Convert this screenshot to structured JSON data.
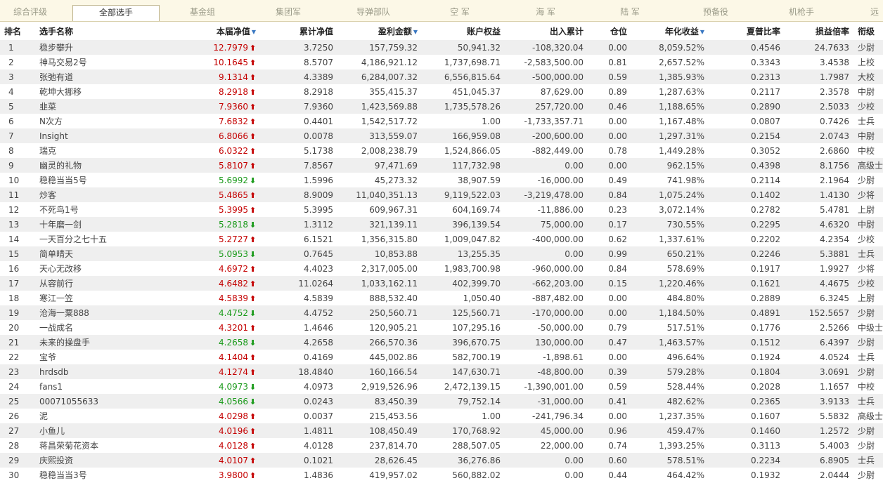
{
  "tabs": [
    {
      "label": "综合评级",
      "active": false
    },
    {
      "label": "全部选手",
      "active": true
    },
    {
      "label": "基金组",
      "active": false
    },
    {
      "label": "集团军",
      "active": false
    },
    {
      "label": "导弹部队",
      "active": false
    },
    {
      "label": "空 军",
      "active": false
    },
    {
      "label": "海 军",
      "active": false
    },
    {
      "label": "陆 军",
      "active": false
    },
    {
      "label": "预备役",
      "active": false
    },
    {
      "label": "机枪手",
      "active": false
    },
    {
      "label": "远",
      "active": false
    }
  ],
  "colors": {
    "up": "#c40000",
    "down": "#1a9a1a",
    "sort": "#3a78c2"
  },
  "table": {
    "headers": [
      "排名",
      "选手名称",
      "本届净值",
      "累计净值",
      "盈利金额",
      "账户权益",
      "出入累计",
      "仓位",
      "年化收益",
      "夏普比率",
      "损益倍率",
      "衔级"
    ],
    "sortable_icon": "sort-down-triangle-icon",
    "rows": [
      {
        "rank": "1",
        "name": "稳步攀升",
        "nav": "12.7979",
        "dir": "up",
        "cum": "3.7250",
        "profit": "157,759.32",
        "equity": "50,941.32",
        "flow": "-108,320.04",
        "pos": "0.00",
        "annual": "8,059.52%",
        "sharpe": "0.4546",
        "pl": "24.7633",
        "grade": "少尉"
      },
      {
        "rank": "2",
        "name": "神马交易2号",
        "nav": "10.1645",
        "dir": "up",
        "cum": "8.5707",
        "profit": "4,186,921.12",
        "equity": "1,737,698.71",
        "flow": "-2,583,500.00",
        "pos": "0.81",
        "annual": "2,657.52%",
        "sharpe": "0.3343",
        "pl": "3.4538",
        "grade": "上校"
      },
      {
        "rank": "3",
        "name": "张弛有道",
        "nav": "9.1314",
        "dir": "up",
        "cum": "4.3389",
        "profit": "6,284,007.32",
        "equity": "6,556,815.64",
        "flow": "-500,000.00",
        "pos": "0.59",
        "annual": "1,385.93%",
        "sharpe": "0.2313",
        "pl": "1.7987",
        "grade": "大校"
      },
      {
        "rank": "4",
        "name": "乾坤大挪移",
        "nav": "8.2918",
        "dir": "up",
        "cum": "8.2918",
        "profit": "355,415.37",
        "equity": "451,045.37",
        "flow": "87,629.00",
        "pos": "0.89",
        "annual": "1,287.63%",
        "sharpe": "0.2117",
        "pl": "2.3578",
        "grade": "中尉"
      },
      {
        "rank": "5",
        "name": "韭菜",
        "nav": "7.9360",
        "dir": "up",
        "cum": "7.9360",
        "profit": "1,423,569.88",
        "equity": "1,735,578.26",
        "flow": "257,720.00",
        "pos": "0.46",
        "annual": "1,188.65%",
        "sharpe": "0.2890",
        "pl": "2.5033",
        "grade": "少校"
      },
      {
        "rank": "6",
        "name": "N次方",
        "nav": "7.6832",
        "dir": "up",
        "cum": "0.4401",
        "profit": "1,542,517.72",
        "equity": "1.00",
        "flow": "-1,733,357.71",
        "pos": "0.00",
        "annual": "1,167.48%",
        "sharpe": "0.0807",
        "pl": "0.7426",
        "grade": "士兵"
      },
      {
        "rank": "7",
        "name": "Insight",
        "nav": "6.8066",
        "dir": "up",
        "cum": "0.0078",
        "profit": "313,559.07",
        "equity": "166,959.08",
        "flow": "-200,600.00",
        "pos": "0.00",
        "annual": "1,297.31%",
        "sharpe": "0.2154",
        "pl": "2.0743",
        "grade": "中尉"
      },
      {
        "rank": "8",
        "name": "瑞克",
        "nav": "6.0322",
        "dir": "up",
        "cum": "5.1738",
        "profit": "2,008,238.79",
        "equity": "1,524,866.05",
        "flow": "-882,449.00",
        "pos": "0.78",
        "annual": "1,449.28%",
        "sharpe": "0.3052",
        "pl": "2.6860",
        "grade": "中校"
      },
      {
        "rank": "9",
        "name": "幽灵的礼物",
        "nav": "5.8107",
        "dir": "up",
        "cum": "7.8567",
        "profit": "97,471.69",
        "equity": "117,732.98",
        "flow": "0.00",
        "pos": "0.00",
        "annual": "962.15%",
        "sharpe": "0.4398",
        "pl": "8.1756",
        "grade": "高级士官"
      },
      {
        "rank": "10",
        "name": "稳稳当当5号",
        "nav": "5.6992",
        "dir": "down",
        "cum": "1.5996",
        "profit": "45,273.32",
        "equity": "38,907.59",
        "flow": "-16,000.00",
        "pos": "0.49",
        "annual": "741.98%",
        "sharpe": "0.2114",
        "pl": "2.1964",
        "grade": "少尉"
      },
      {
        "rank": "11",
        "name": "炒客",
        "nav": "5.4865",
        "dir": "up",
        "cum": "8.9009",
        "profit": "11,040,351.13",
        "equity": "9,119,522.03",
        "flow": "-3,219,478.00",
        "pos": "0.84",
        "annual": "1,075.24%",
        "sharpe": "0.1402",
        "pl": "1.4130",
        "grade": "少将"
      },
      {
        "rank": "12",
        "name": "不死鸟1号",
        "nav": "5.3995",
        "dir": "up",
        "cum": "5.3995",
        "profit": "609,967.31",
        "equity": "604,169.74",
        "flow": "-11,886.00",
        "pos": "0.23",
        "annual": "3,072.14%",
        "sharpe": "0.2782",
        "pl": "5.4781",
        "grade": "上尉"
      },
      {
        "rank": "13",
        "name": "十年磨一剑",
        "nav": "5.2818",
        "dir": "down",
        "cum": "1.3112",
        "profit": "321,139.11",
        "equity": "396,139.54",
        "flow": "75,000.00",
        "pos": "0.17",
        "annual": "730.55%",
        "sharpe": "0.2295",
        "pl": "4.6320",
        "grade": "中尉"
      },
      {
        "rank": "14",
        "name": "一天百分之七十五",
        "nav": "5.2727",
        "dir": "up",
        "cum": "6.1521",
        "profit": "1,356,315.80",
        "equity": "1,009,047.82",
        "flow": "-400,000.00",
        "pos": "0.62",
        "annual": "1,337.61%",
        "sharpe": "0.2202",
        "pl": "4.2354",
        "grade": "少校"
      },
      {
        "rank": "15",
        "name": "简单晴天",
        "nav": "5.0953",
        "dir": "down",
        "cum": "0.7645",
        "profit": "10,853.88",
        "equity": "13,255.35",
        "flow": "0.00",
        "pos": "0.99",
        "annual": "650.21%",
        "sharpe": "0.2246",
        "pl": "5.3881",
        "grade": "士兵"
      },
      {
        "rank": "16",
        "name": "天心无改移",
        "nav": "4.6972",
        "dir": "up",
        "cum": "4.4023",
        "profit": "2,317,005.00",
        "equity": "1,983,700.98",
        "flow": "-960,000.00",
        "pos": "0.84",
        "annual": "578.69%",
        "sharpe": "0.1917",
        "pl": "1.9927",
        "grade": "少将"
      },
      {
        "rank": "17",
        "name": "从容前行",
        "nav": "4.6482",
        "dir": "up",
        "cum": "11.0264",
        "profit": "1,033,162.11",
        "equity": "402,399.70",
        "flow": "-662,203.00",
        "pos": "0.15",
        "annual": "1,220.46%",
        "sharpe": "0.1621",
        "pl": "4.4675",
        "grade": "少校"
      },
      {
        "rank": "18",
        "name": "寒江一笠",
        "nav": "4.5839",
        "dir": "up",
        "cum": "4.5839",
        "profit": "888,532.40",
        "equity": "1,050.40",
        "flow": "-887,482.00",
        "pos": "0.00",
        "annual": "484.80%",
        "sharpe": "0.2889",
        "pl": "6.3245",
        "grade": "上尉"
      },
      {
        "rank": "19",
        "name": "沧海一粟888",
        "nav": "4.4752",
        "dir": "down",
        "cum": "4.4752",
        "profit": "250,560.71",
        "equity": "125,560.71",
        "flow": "-170,000.00",
        "pos": "0.00",
        "annual": "1,184.50%",
        "sharpe": "0.4891",
        "pl": "152.5657",
        "grade": "少尉"
      },
      {
        "rank": "20",
        "name": "一战成名",
        "nav": "4.3201",
        "dir": "up",
        "cum": "1.4646",
        "profit": "120,905.21",
        "equity": "107,295.16",
        "flow": "-50,000.00",
        "pos": "0.79",
        "annual": "517.51%",
        "sharpe": "0.1776",
        "pl": "2.5266",
        "grade": "中级士官"
      },
      {
        "rank": "21",
        "name": "未来的操盘手",
        "nav": "4.2658",
        "dir": "down",
        "cum": "4.2658",
        "profit": "266,570.36",
        "equity": "396,670.75",
        "flow": "130,000.00",
        "pos": "0.47",
        "annual": "1,463.57%",
        "sharpe": "0.1512",
        "pl": "6.4397",
        "grade": "少尉"
      },
      {
        "rank": "22",
        "name": "宝爷",
        "nav": "4.1404",
        "dir": "up",
        "cum": "0.4169",
        "profit": "445,002.86",
        "equity": "582,700.19",
        "flow": "-1,898.61",
        "pos": "0.00",
        "annual": "496.64%",
        "sharpe": "0.1924",
        "pl": "4.0524",
        "grade": "士兵"
      },
      {
        "rank": "23",
        "name": "hrdsdb",
        "nav": "4.1274",
        "dir": "up",
        "cum": "18.4840",
        "profit": "160,166.54",
        "equity": "147,630.71",
        "flow": "-48,800.00",
        "pos": "0.39",
        "annual": "579.28%",
        "sharpe": "0.1804",
        "pl": "3.0691",
        "grade": "少尉"
      },
      {
        "rank": "24",
        "name": "fans1",
        "nav": "4.0973",
        "dir": "down",
        "cum": "4.0973",
        "profit": "2,919,526.96",
        "equity": "2,472,139.15",
        "flow": "-1,390,001.00",
        "pos": "0.59",
        "annual": "528.44%",
        "sharpe": "0.2028",
        "pl": "1.1657",
        "grade": "中校"
      },
      {
        "rank": "25",
        "name": "00071055633",
        "nav": "4.0566",
        "dir": "down",
        "cum": "0.0243",
        "profit": "83,450.39",
        "equity": "79,752.14",
        "flow": "-31,000.00",
        "pos": "0.41",
        "annual": "482.62%",
        "sharpe": "0.2365",
        "pl": "3.9133",
        "grade": "士兵"
      },
      {
        "rank": "26",
        "name": "泥",
        "nav": "4.0298",
        "dir": "up",
        "cum": "0.0037",
        "profit": "215,453.56",
        "equity": "1.00",
        "flow": "-241,796.34",
        "pos": "0.00",
        "annual": "1,237.35%",
        "sharpe": "0.1607",
        "pl": "5.5832",
        "grade": "高级士官"
      },
      {
        "rank": "27",
        "name": "小鱼儿",
        "nav": "4.0196",
        "dir": "up",
        "cum": "1.4811",
        "profit": "108,450.49",
        "equity": "170,768.92",
        "flow": "45,000.00",
        "pos": "0.96",
        "annual": "459.47%",
        "sharpe": "0.1460",
        "pl": "1.2572",
        "grade": "少尉"
      },
      {
        "rank": "28",
        "name": "蒋昌荣菊花资本",
        "nav": "4.0128",
        "dir": "up",
        "cum": "4.0128",
        "profit": "237,814.70",
        "equity": "288,507.05",
        "flow": "22,000.00",
        "pos": "0.74",
        "annual": "1,393.25%",
        "sharpe": "0.3113",
        "pl": "5.4003",
        "grade": "少尉"
      },
      {
        "rank": "29",
        "name": "庆熙投资",
        "nav": "4.0107",
        "dir": "up",
        "cum": "0.1021",
        "profit": "28,626.45",
        "equity": "36,276.86",
        "flow": "0.00",
        "pos": "0.60",
        "annual": "578.51%",
        "sharpe": "0.2234",
        "pl": "6.8905",
        "grade": "士兵"
      },
      {
        "rank": "30",
        "name": "稳稳当当3号",
        "nav": "3.9800",
        "dir": "up",
        "cum": "1.4836",
        "profit": "419,957.02",
        "equity": "560,882.02",
        "flow": "0.00",
        "pos": "0.44",
        "annual": "464.42%",
        "sharpe": "0.1932",
        "pl": "2.0444",
        "grade": "少尉"
      }
    ]
  }
}
